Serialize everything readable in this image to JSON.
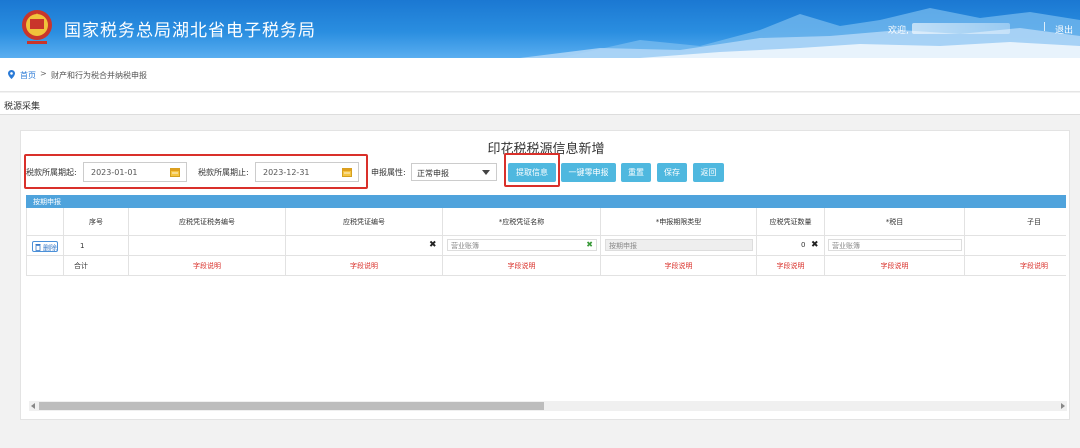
{
  "header": {
    "title": "国家税务总局湖北省电子税务局",
    "welcome": "欢迎,",
    "separator": "|",
    "logout": "退出"
  },
  "breadcrumb": {
    "home": "首页",
    "arrow": ">",
    "current": "财产和行为税合并纳税申报"
  },
  "section": {
    "title": "税源采集"
  },
  "form": {
    "page_title": "印花税税源信息新增",
    "period_start_label": "税款所属期起:",
    "period_start_value": "2023-01-01",
    "period_end_label": "税款所属期止:",
    "period_end_value": "2023-12-31",
    "declare_attr_label": "申报属性:",
    "declare_attr_value": "正常申报",
    "buttons": {
      "fetch": "提取信息",
      "zero_declare": "一键零申报",
      "reset": "重置",
      "save": "保存",
      "back": "返回"
    }
  },
  "table": {
    "bar_title": "按期申报",
    "columns": [
      "序号",
      "应税凭证税务编号",
      "应税凭证编号",
      "*应税凭证名称",
      "*申报期限类型",
      "应税凭证数量",
      "*税目",
      "子目"
    ],
    "row": {
      "delete_label": "删除",
      "index": "1",
      "voucher_name": "营业账簿",
      "period_type": "按期申报",
      "quantity": "0",
      "tax_item": "营业账簿"
    },
    "total_label": "合计",
    "field_note": "字段说明"
  },
  "colors": {
    "header_blue": "#1b78d2",
    "button_cyan": "#4fb8df",
    "highlight_red": "#d9302a",
    "table_bar": "#4fa3dc"
  }
}
